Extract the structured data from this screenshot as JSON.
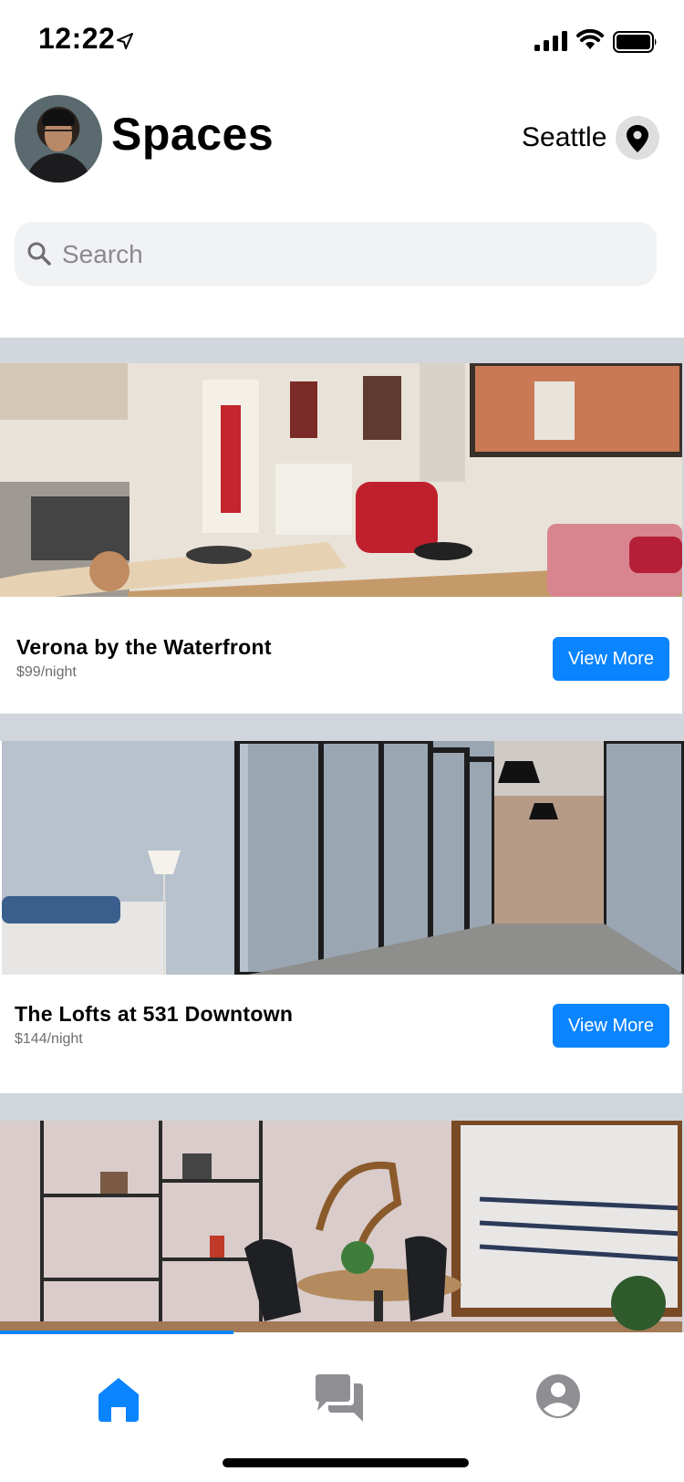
{
  "status_bar": {
    "time": "12:22"
  },
  "header": {
    "title": "Spaces",
    "location": "Seattle"
  },
  "search": {
    "placeholder": "Search",
    "value": ""
  },
  "listings": [
    {
      "name": "Verona by the Waterfront",
      "price": "$99/night",
      "button_label": "View More"
    },
    {
      "name": "The Lofts at 531 Downtown",
      "price": "$144/night",
      "button_label": "View More"
    },
    {
      "name": "",
      "price": "",
      "button_label": ""
    }
  ],
  "tab_bar": {
    "active": "home",
    "items": [
      {
        "icon": "home-icon"
      },
      {
        "icon": "chat-icon"
      },
      {
        "icon": "account-icon"
      }
    ]
  },
  "colors": {
    "accent": "#0a84ff",
    "feed_background": "#d0d6db",
    "inactive_tab": "#8e8e93"
  }
}
